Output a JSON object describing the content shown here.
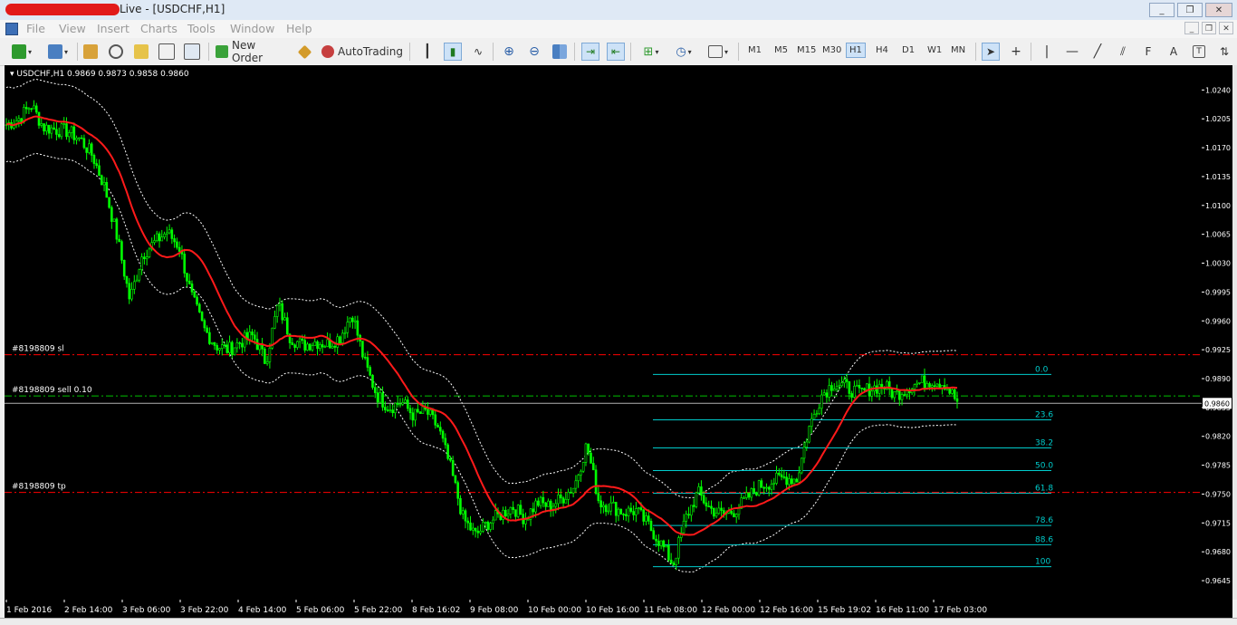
{
  "window": {
    "title": "Live - [USDCHF,H1]",
    "controls": [
      "_",
      "❐",
      "✕"
    ],
    "child_controls": [
      "_",
      "❐",
      "✕"
    ]
  },
  "menu": [
    "File",
    "View",
    "Insert",
    "Charts",
    "Tools",
    "Window",
    "Help"
  ],
  "toolbar": {
    "new_order": "New Order",
    "autotrading": "AutoTrading",
    "timeframes": [
      "M1",
      "M5",
      "M15",
      "M30",
      "H1",
      "H4",
      "D1",
      "W1",
      "MN"
    ],
    "active_timeframe": "H1",
    "text_tool": "A"
  },
  "chart": {
    "header": "USDCHF,H1  0.9869 0.9873 0.9858 0.9860",
    "symbol": "USDCHF",
    "timeframe": "H1",
    "ohlc": {
      "open": 0.9869,
      "high": 0.9873,
      "low": 0.9858,
      "close": 0.986
    },
    "current_price_label": "0.9860",
    "order_lines": [
      {
        "label": "#8198809 sl",
        "price": 0.9919,
        "color": "#ff0000"
      },
      {
        "label": "#8198809 sell 0.10",
        "price": 0.9869,
        "color": "#00c000"
      },
      {
        "label": "#8198809 tp",
        "price": 0.9752,
        "color": "#ff0000"
      }
    ],
    "fibonacci": {
      "from": 0.9662,
      "to": 0.9895,
      "color": "#00cccc",
      "levels": [
        {
          "label": "0.0",
          "ratio": 0.0
        },
        {
          "label": "23.6",
          "ratio": 0.236
        },
        {
          "label": "38.2",
          "ratio": 0.382
        },
        {
          "label": "50.0",
          "ratio": 0.5
        },
        {
          "label": "61.8",
          "ratio": 0.618
        },
        {
          "label": "78.6",
          "ratio": 0.786
        },
        {
          "label": "88.6",
          "ratio": 0.886
        },
        {
          "label": "100",
          "ratio": 1.0
        }
      ]
    },
    "y_axis_ticks": [
      "1.0240",
      "1.0205",
      "1.0170",
      "1.0135",
      "1.0100",
      "1.0065",
      "1.0030",
      "0.9995",
      "0.9960",
      "0.9925",
      "0.9890",
      "0.9855",
      "0.9820",
      "0.9785",
      "0.9750",
      "0.9715",
      "0.9680",
      "0.9645"
    ],
    "x_axis_ticks": [
      "1 Feb 2016",
      "2 Feb 14:00",
      "3 Feb 06:00",
      "3 Feb 22:00",
      "4 Feb 14:00",
      "5 Feb 06:00",
      "5 Feb 22:00",
      "8 Feb 16:02",
      "9 Feb 08:00",
      "10 Feb 00:00",
      "10 Feb 16:00",
      "11 Feb 08:00",
      "12 Feb 00:00",
      "12 Feb 16:00",
      "15 Feb 19:02",
      "16 Feb 11:00",
      "17 Feb 03:00"
    ],
    "price_path": [
      1.0198,
      1.0205,
      1.0222,
      1.0195,
      1.0192,
      1.019,
      1.018,
      1.016,
      1.012,
      1.006,
      0.9985,
      1.004,
      1.0055,
      1.0068,
      1.005,
      0.999,
      0.995,
      0.993,
      0.9925,
      0.9935,
      0.9942,
      0.991,
      0.998,
      0.994,
      0.993,
      0.9935,
      0.9932,
      0.994,
      0.997,
      0.991,
      0.987,
      0.9855,
      0.9862,
      0.9845,
      0.985,
      0.983,
      0.978,
      0.972,
      0.97,
      0.9715,
      0.9725,
      0.9735,
      0.972,
      0.974,
      0.9735,
      0.9745,
      0.976,
      0.981,
      0.974,
      0.9735,
      0.9728,
      0.973,
      0.9712,
      0.969,
      0.9665,
      0.972,
      0.9752,
      0.9732,
      0.9725,
      0.973,
      0.9745,
      0.976,
      0.9765,
      0.977,
      0.9768,
      0.983,
      0.987,
      0.9885,
      0.988,
      0.9872,
      0.9878,
      0.9882,
      0.987,
      0.988,
      0.9885,
      0.9888,
      0.9884,
      0.9862
    ]
  }
}
